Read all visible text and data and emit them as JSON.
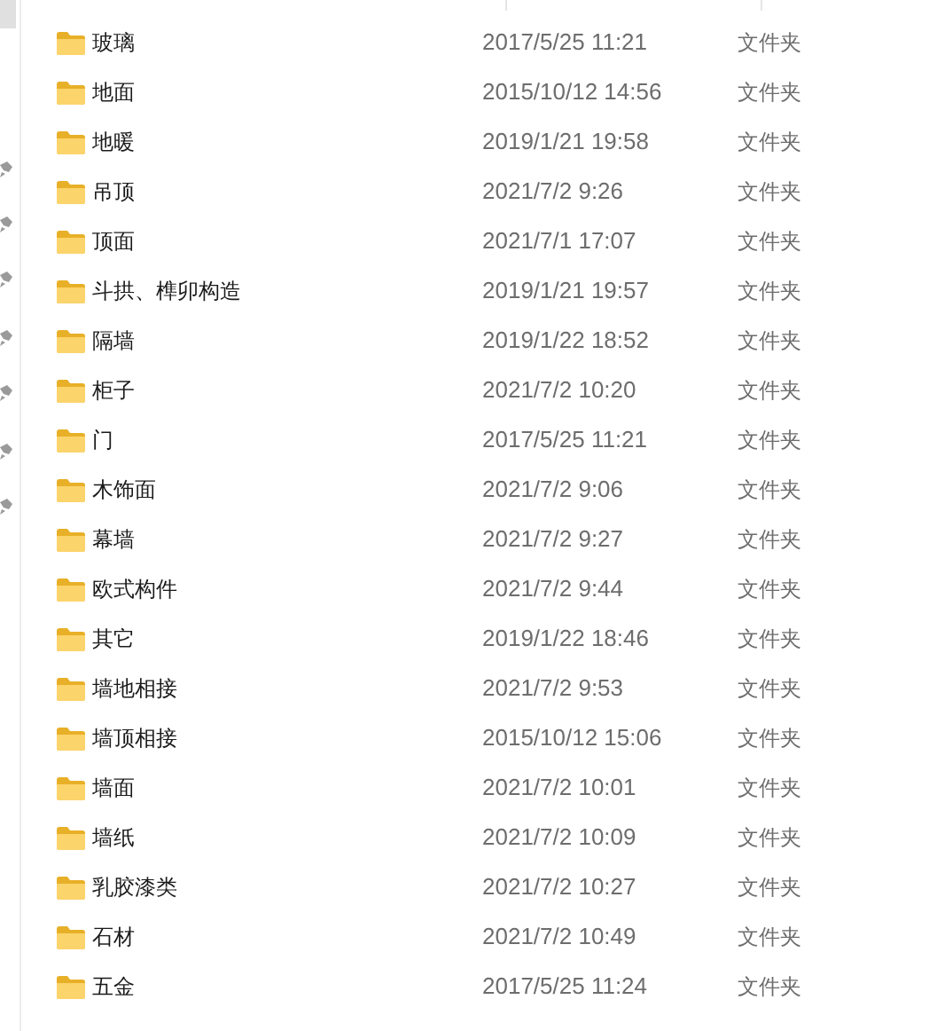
{
  "files": [
    {
      "name": "玻璃",
      "modified": "2017/5/25 11:21",
      "type": "文件夹"
    },
    {
      "name": "地面",
      "modified": "2015/10/12 14:56",
      "type": "文件夹"
    },
    {
      "name": "地暖",
      "modified": "2019/1/21 19:58",
      "type": "文件夹"
    },
    {
      "name": "吊顶",
      "modified": "2021/7/2 9:26",
      "type": "文件夹"
    },
    {
      "name": "顶面",
      "modified": "2021/7/1 17:07",
      "type": "文件夹"
    },
    {
      "name": "斗拱、榫卯构造",
      "modified": "2019/1/21 19:57",
      "type": "文件夹"
    },
    {
      "name": "隔墙",
      "modified": "2019/1/22 18:52",
      "type": "文件夹"
    },
    {
      "name": "柜子",
      "modified": "2021/7/2 10:20",
      "type": "文件夹"
    },
    {
      "name": "门",
      "modified": "2017/5/25 11:21",
      "type": "文件夹"
    },
    {
      "name": "木饰面",
      "modified": "2021/7/2 9:06",
      "type": "文件夹"
    },
    {
      "name": "幕墙",
      "modified": "2021/7/2 9:27",
      "type": "文件夹"
    },
    {
      "name": "欧式构件",
      "modified": "2021/7/2 9:44",
      "type": "文件夹"
    },
    {
      "name": "其它",
      "modified": "2019/1/22 18:46",
      "type": "文件夹"
    },
    {
      "name": "墙地相接",
      "modified": "2021/7/2 9:53",
      "type": "文件夹"
    },
    {
      "name": "墙顶相接",
      "modified": "2015/10/12 15:06",
      "type": "文件夹"
    },
    {
      "name": "墙面",
      "modified": "2021/7/2 10:01",
      "type": "文件夹"
    },
    {
      "name": "墙纸",
      "modified": "2021/7/2 10:09",
      "type": "文件夹"
    },
    {
      "name": "乳胶漆类",
      "modified": "2021/7/2 10:27",
      "type": "文件夹"
    },
    {
      "name": "石材",
      "modified": "2021/7/2 10:49",
      "type": "文件夹"
    },
    {
      "name": "五金",
      "modified": "2017/5/25 11:24",
      "type": "文件夹"
    }
  ]
}
